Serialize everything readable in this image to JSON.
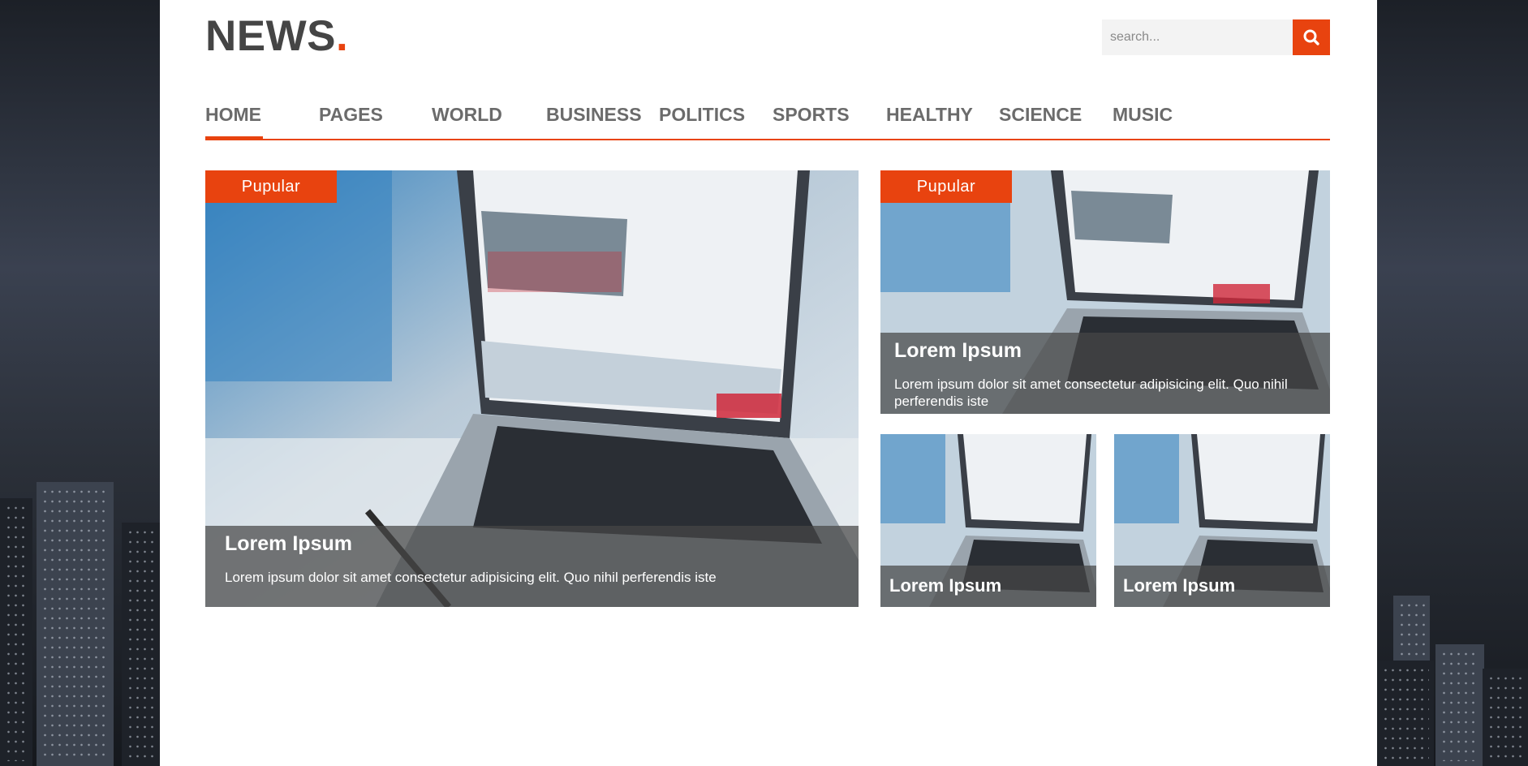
{
  "brand": {
    "name": "NEWS",
    "dot": ".",
    "accent_color": "#e8430f",
    "text_color": "#454545"
  },
  "search": {
    "placeholder": "search...",
    "icon": "search-icon"
  },
  "nav": {
    "items": [
      {
        "label": "HOME",
        "active": true
      },
      {
        "label": "PAGES"
      },
      {
        "label": "WORLD"
      },
      {
        "label": "BUSINESS"
      },
      {
        "label": "POLITICS"
      },
      {
        "label": "SPORTS"
      },
      {
        "label": "HEALTHY"
      },
      {
        "label": "SCIENCE"
      },
      {
        "label": "MUSIC"
      }
    ]
  },
  "featured": {
    "main": {
      "badge": "Pupular",
      "title": "Lorem Ipsum",
      "text": "Lorem ipsum dolor sit amet consectetur adipisicing elit. Quo nihil perferendis iste"
    },
    "side": {
      "badge": "Pupular",
      "title": "Lorem Ipsum",
      "text": "Lorem ipsum dolor sit amet consectetur adipisicing elit. Quo nihil perferendis iste"
    },
    "small": [
      {
        "title": "Lorem Ipsum"
      },
      {
        "title": "Lorem Ipsum"
      }
    ]
  }
}
